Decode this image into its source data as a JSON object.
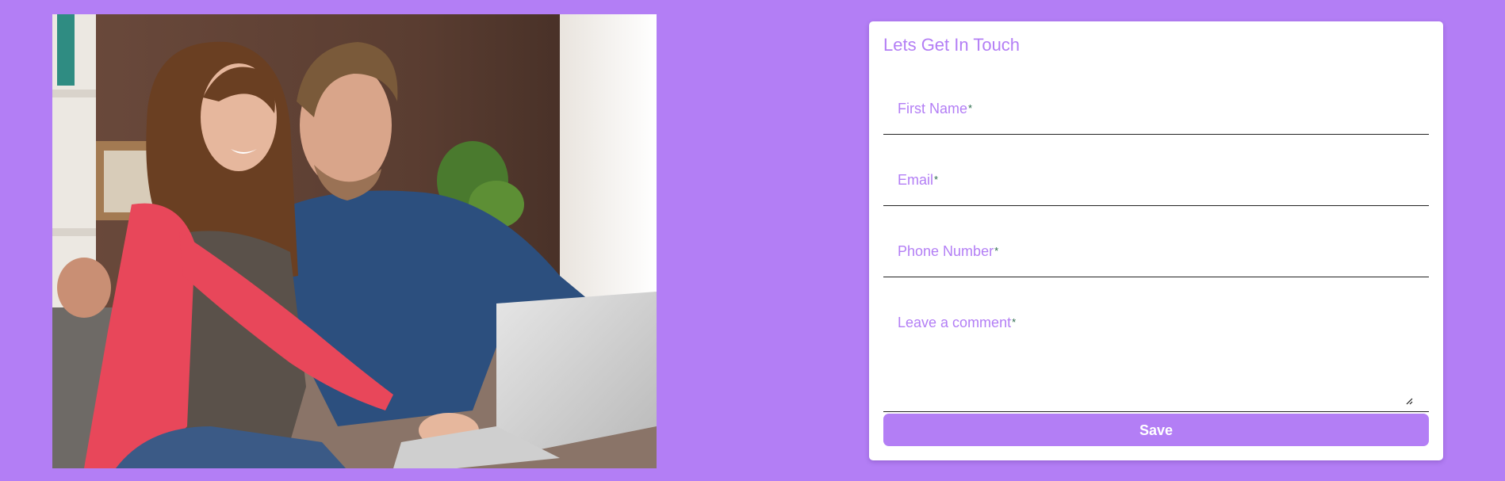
{
  "colors": {
    "background": "#b37ef5",
    "card": "#ffffff",
    "accent": "#b37ef5",
    "required_marker": "#2a6a4a",
    "underline": "#222222"
  },
  "image": {
    "icon": "photo-couple-laptop"
  },
  "form": {
    "title": "Lets Get In Touch",
    "fields": [
      {
        "label": "First Name",
        "required": "*",
        "value": ""
      },
      {
        "label": "Email",
        "required": "*",
        "value": ""
      },
      {
        "label": "Phone Number",
        "required": "*",
        "value": ""
      },
      {
        "label": "Leave a comment",
        "required": "*",
        "value": ""
      }
    ],
    "save_label": "Save"
  }
}
